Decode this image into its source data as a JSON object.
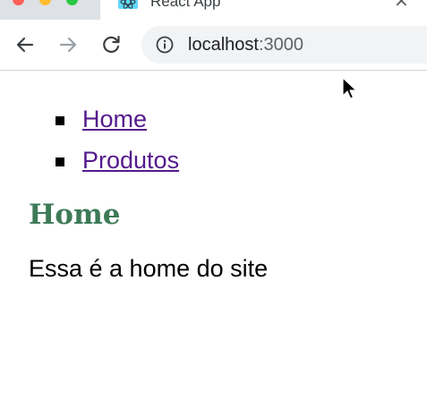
{
  "browser": {
    "tab": {
      "title": "React App",
      "favicon": "react-icon",
      "close": "✕"
    },
    "address_bar": {
      "host": "localhost",
      "port": ":3000",
      "icon": "info-icon"
    },
    "nav": {
      "back": "arrow-left-icon",
      "forward": "arrow-right-icon",
      "reload": "reload-icon"
    }
  },
  "page": {
    "nav": [
      {
        "label": "Home"
      },
      {
        "label": "Produtos"
      }
    ],
    "title": "Home",
    "text": "Essa é a home do site"
  },
  "colors": {
    "link": "#551a8b",
    "title": "#3d7a57",
    "omnibox_bg": "#f1f3f4",
    "tabstrip_bg": "#dee1e6"
  }
}
